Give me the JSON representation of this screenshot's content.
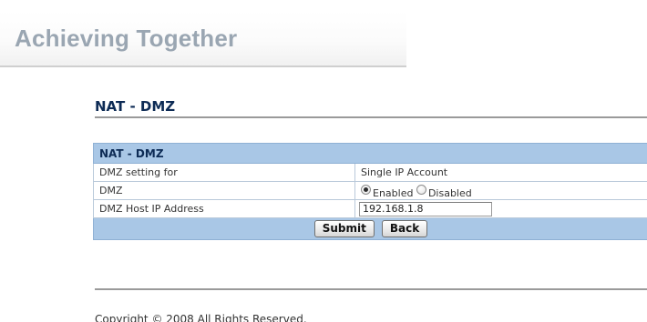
{
  "brand": {
    "tagline": "Achieving Together"
  },
  "page": {
    "title": "NAT - DMZ"
  },
  "form": {
    "header": "NAT - DMZ",
    "rows": {
      "dmz_setting": {
        "label": "DMZ setting for",
        "value": "Single IP Account"
      },
      "dmz": {
        "label": "DMZ",
        "options": {
          "enabled": "Enabled",
          "disabled": "Disabled"
        },
        "selected": "Enabled"
      },
      "host_ip": {
        "label": "DMZ Host IP Address",
        "value": "192.168.1.8"
      }
    },
    "buttons": {
      "submit": "Submit",
      "back": "Back"
    }
  },
  "footer": {
    "copyright": "Copyright © 2008 All Rights Reserved."
  }
}
